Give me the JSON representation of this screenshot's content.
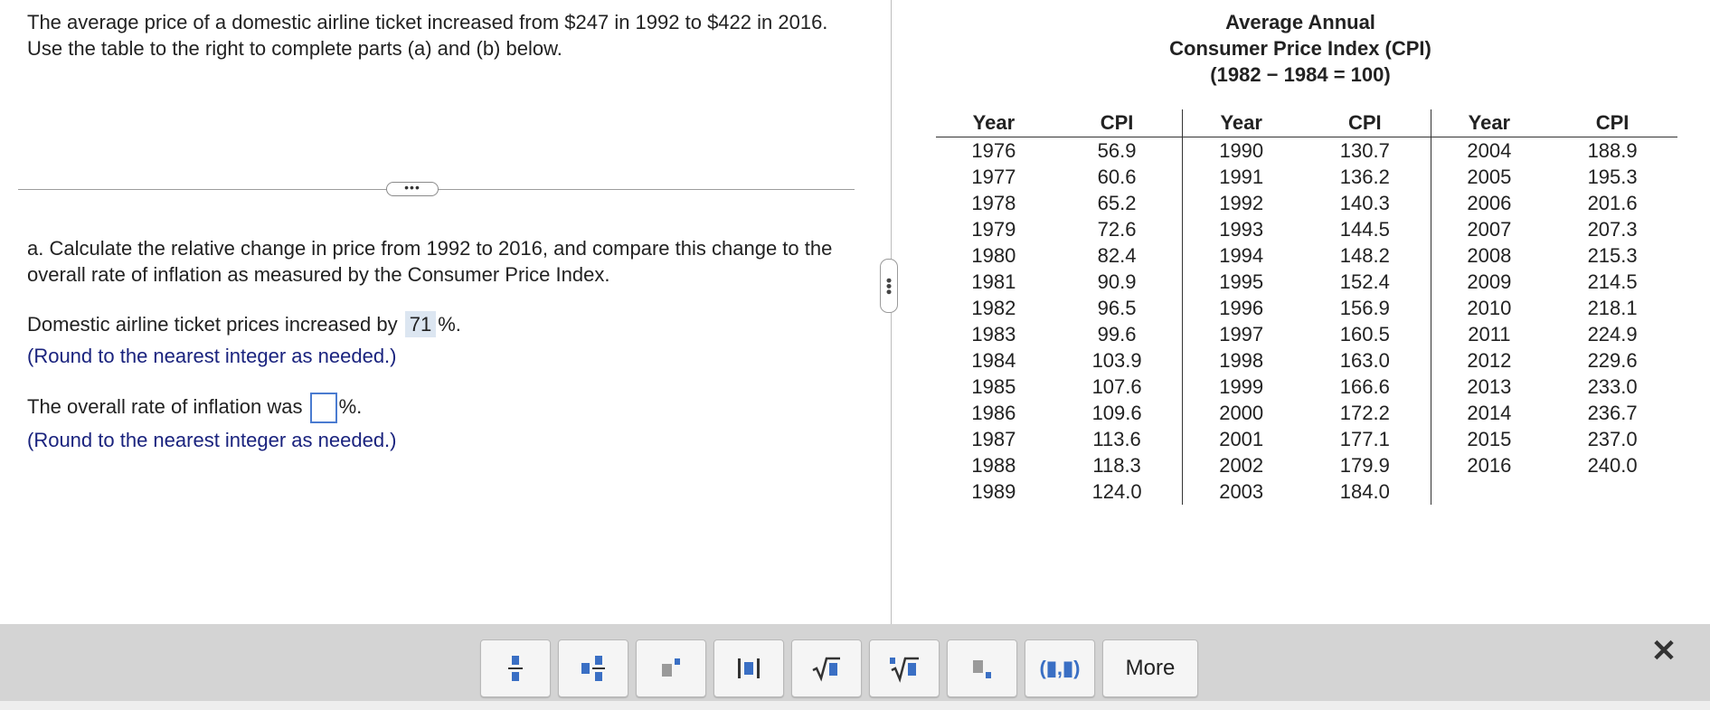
{
  "problem": {
    "intro": "The average price of a domestic airline ticket increased from $247 in 1992 to $422 in 2016. Use the table to the right to complete parts (a) and (b) below.",
    "expand_label": "•••",
    "part_a": "a. Calculate the relative change in price from 1992 to 2016, and compare this change to the overall rate of inflation as measured by the Consumer Price Index.",
    "q1_prefix": "Domestic airline ticket prices increased by",
    "q1_answer": "71",
    "q1_suffix": "%.",
    "q1_hint": "(Round to the nearest integer as needed.)",
    "q2_prefix": "The overall rate of inflation was",
    "q2_suffix": "%.",
    "q2_hint": "(Round to the nearest integer as needed.)"
  },
  "cpi": {
    "title_line1": "Average Annual",
    "title_line2": "Consumer Price Index (CPI)",
    "title_line3": "(1982 − 1984 = 100)",
    "headers": [
      "Year",
      "CPI",
      "Year",
      "CPI",
      "Year",
      "CPI"
    ],
    "rows": [
      [
        "1976",
        "56.9",
        "1990",
        "130.7",
        "2004",
        "188.9"
      ],
      [
        "1977",
        "60.6",
        "1991",
        "136.2",
        "2005",
        "195.3"
      ],
      [
        "1978",
        "65.2",
        "1992",
        "140.3",
        "2006",
        "201.6"
      ],
      [
        "1979",
        "72.6",
        "1993",
        "144.5",
        "2007",
        "207.3"
      ],
      [
        "1980",
        "82.4",
        "1994",
        "148.2",
        "2008",
        "215.3"
      ],
      [
        "1981",
        "90.9",
        "1995",
        "152.4",
        "2009",
        "214.5"
      ],
      [
        "1982",
        "96.5",
        "1996",
        "156.9",
        "2010",
        "218.1"
      ],
      [
        "1983",
        "99.6",
        "1997",
        "160.5",
        "2011",
        "224.9"
      ],
      [
        "1984",
        "103.9",
        "1998",
        "163.0",
        "2012",
        "229.6"
      ],
      [
        "1985",
        "107.6",
        "1999",
        "166.6",
        "2013",
        "233.0"
      ],
      [
        "1986",
        "109.6",
        "2000",
        "172.2",
        "2014",
        "236.7"
      ],
      [
        "1987",
        "113.6",
        "2001",
        "177.1",
        "2015",
        "237.0"
      ],
      [
        "1988",
        "118.3",
        "2002",
        "179.9",
        "2016",
        "240.0"
      ],
      [
        "1989",
        "124.0",
        "2003",
        "184.0",
        "",
        ""
      ]
    ]
  },
  "toolbar": {
    "buttons": [
      "fraction-icon",
      "mixed-number-icon",
      "exponent-icon",
      "absolute-value-icon",
      "square-root-icon",
      "nth-root-icon",
      "subscript-icon",
      "ordered-pair-icon"
    ],
    "ordered_pair_label": "(▮,▮)",
    "more_label": "More",
    "close_label": "✕"
  },
  "colors": {
    "accent": "#3a6fc4",
    "hint": "#1a237e",
    "answer_bg": "#dce6f1",
    "toolbar_bg": "#d4d4d4"
  }
}
